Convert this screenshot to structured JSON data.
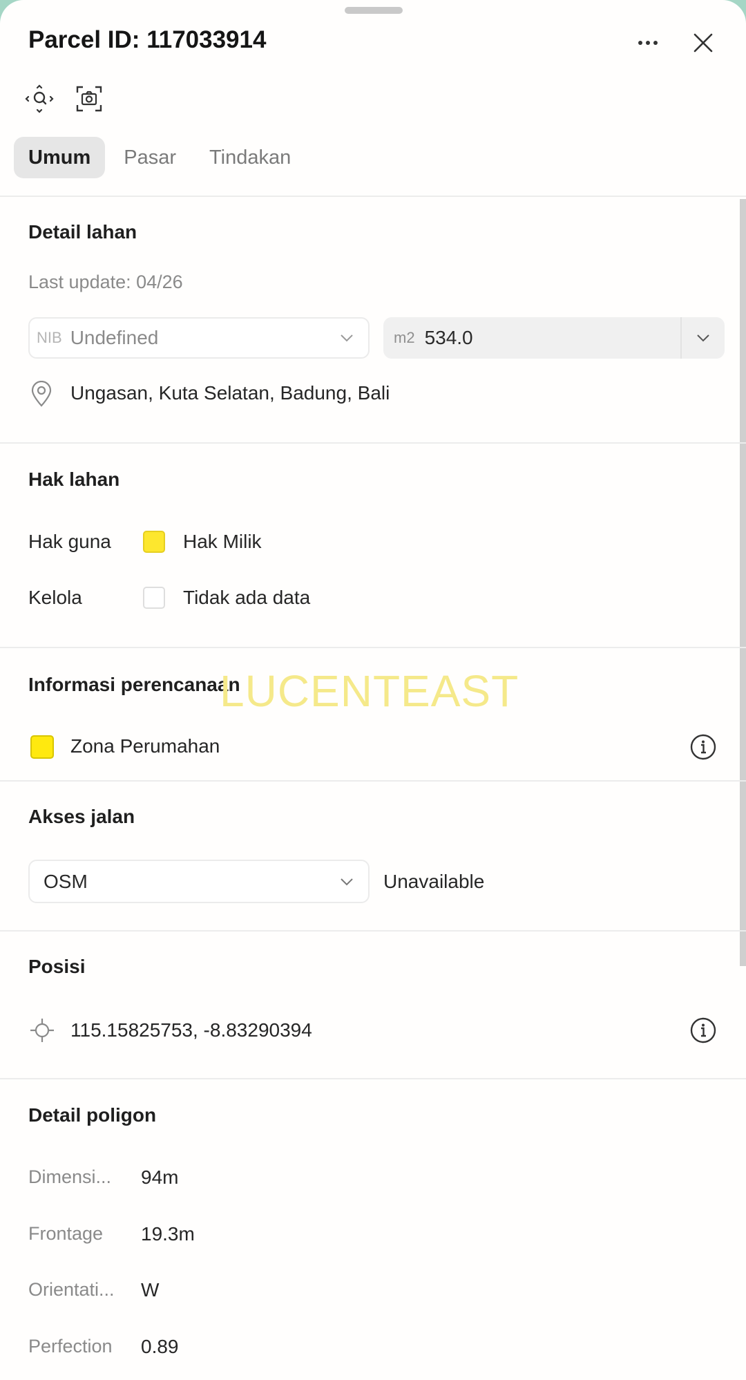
{
  "header": {
    "title": "Parcel ID: 117033914",
    "more_icon": "more-horizontal-icon",
    "close_icon": "close-icon"
  },
  "toolbar": {
    "locate_icon": "locate-parcel-icon",
    "screenshot_icon": "camera-capture-icon"
  },
  "tabs": [
    {
      "label": "Umum",
      "active": true
    },
    {
      "label": "Pasar",
      "active": false
    },
    {
      "label": "Tindakan",
      "active": false
    }
  ],
  "detail_lahan": {
    "title": "Detail lahan",
    "last_update": "Last update: 04/26",
    "nib": {
      "prefix": "NIB",
      "value": "Undefined"
    },
    "area": {
      "prefix": "m2",
      "value": "534.0"
    },
    "location": "Ungasan, Kuta Selatan, Badung, Bali"
  },
  "hak_lahan": {
    "title": "Hak lahan",
    "rows": [
      {
        "label": "Hak guna",
        "value": "Hak Milik",
        "color": "#fde72e"
      },
      {
        "label": "Kelola",
        "value": "Tidak ada data",
        "color": "#ffffff"
      }
    ]
  },
  "informasi_perencanaan": {
    "title": "Informasi perencanaan",
    "zone": "Zona Perumahan",
    "zone_color": "#ffe90f"
  },
  "watermark": "LUCENTEAST",
  "akses_jalan": {
    "title": "Akses jalan",
    "source": "OSM",
    "status": "Unavailable"
  },
  "posisi": {
    "title": "Posisi",
    "coordinates": "115.15825753, -8.83290394"
  },
  "detail_poligon": {
    "title": "Detail poligon",
    "rows": [
      {
        "label": "Dimensi...",
        "value": "94m"
      },
      {
        "label": "Frontage",
        "value": "19.3m"
      },
      {
        "label": "Orientati...",
        "value": "W"
      },
      {
        "label": "Perfection",
        "value": "0.89"
      }
    ]
  }
}
